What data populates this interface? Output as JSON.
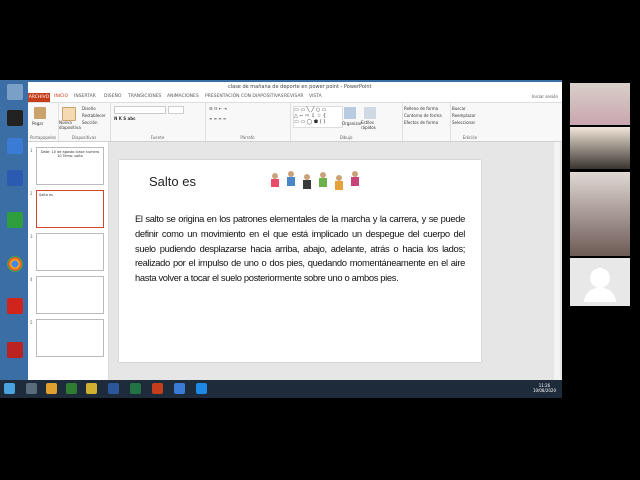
{
  "window": {
    "title": "clase de mañana de deporte en power point  -  PowerPoint",
    "user": "Iniciar sesión"
  },
  "ribbon_tabs": [
    "ARCHIVO",
    "INICIO",
    "INSERTAR",
    "DISEÑO",
    "TRANSICIONES",
    "ANIMACIONES",
    "PRESENTACIÓN CON DIAPOSITIVAS",
    "REVISAR",
    "VISTA"
  ],
  "ribbon": {
    "paste": "Pegar",
    "clipboard": "Portapapeles",
    "new_slide": "Nueva diapositiva",
    "layout": "Diseño",
    "reset": "Restablecer",
    "section": "Sección",
    "slides_group": "Diapositivas",
    "font_group": "Fuente",
    "paragraph_group": "Párrafo",
    "arrange": "Organizar",
    "quick_styles": "Estilos rápidos",
    "shape_fill": "Relleno de forma",
    "shape_outline": "Contorno de forma",
    "shape_effects": "Efectos de forma",
    "drawing_group": "Dibujo",
    "find": "Buscar",
    "replace": "Reemplazar",
    "select": "Seleccionar",
    "editing_group": "Edición"
  },
  "thumbnails": [
    {
      "num": "1",
      "text": "Date: 10 de agosto clase numero 10 Tema: salto"
    },
    {
      "num": "2",
      "text": "Salto es"
    },
    {
      "num": "3",
      "text": ""
    },
    {
      "num": "4",
      "text": ""
    },
    {
      "num": "5",
      "text": ""
    }
  ],
  "slide": {
    "title": "Salto es",
    "body": "El salto se origina en los patrones elementales de la marcha y la carrera, y se puede definir como un movimiento en el que está implicado un despegue del cuerpo del suelo pudiendo desplazarse hacia arriba, abajo, adelante, atrás o hacia los lados; realizado por el impulso de uno o dos pies, quedando momentáneamente en el aire hasta volver a tocar el suelo posteriormente sobre uno o ambos pies."
  },
  "taskbar": {
    "time": "11:26",
    "date": "10/08/2020"
  },
  "colors": {
    "accent": "#c43e1c",
    "desktop": "#3a6ea5",
    "taskbar": "#1e2b3a"
  }
}
